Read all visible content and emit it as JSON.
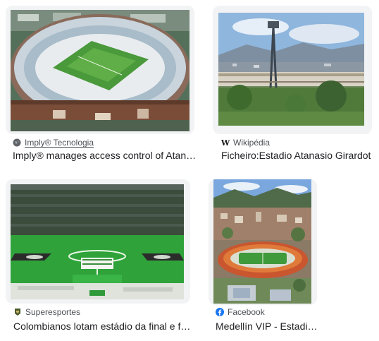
{
  "results": [
    {
      "source": "Imply® Tecnologia",
      "source_icon": "globe-icon",
      "caption": "Imply® manages access control of Atanasio Girardot stadium",
      "accent": "#1a73e8"
    },
    {
      "source": "Wikipédia",
      "source_icon": "wikipedia-icon",
      "caption": "Ficheiro:Estadio Atanasio Girardot",
      "accent": "#202124"
    },
    {
      "source": "Superesportes",
      "source_icon": "superesportes-icon",
      "caption": "Colombianos lotam estádio da final e fazem homenagem",
      "accent": "#4b5a2a"
    },
    {
      "source": "Facebook",
      "source_icon": "facebook-icon",
      "caption": "Medellín VIP - Estadio Atanasio Girardot",
      "accent": "#1877f2"
    }
  ]
}
